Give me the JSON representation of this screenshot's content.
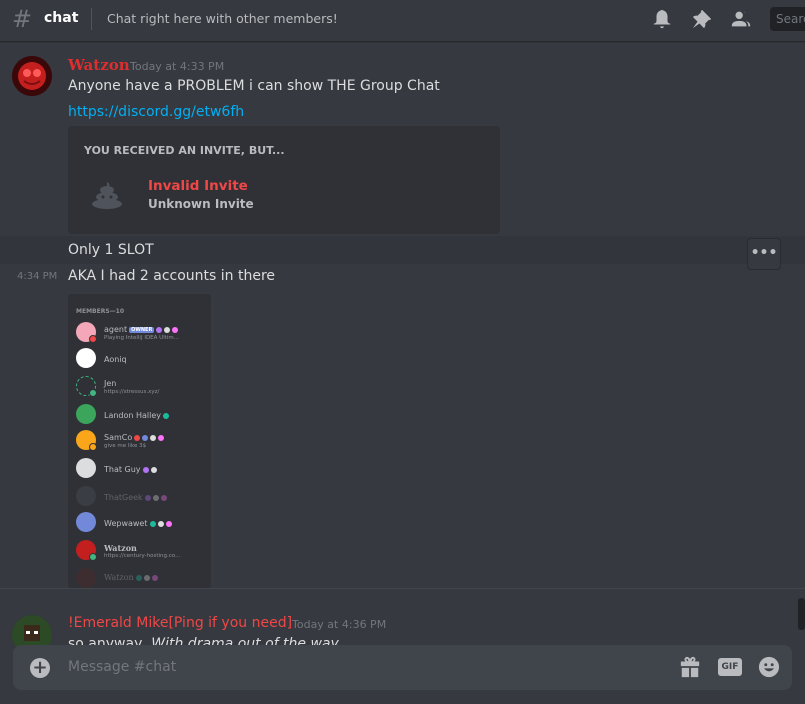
{
  "header": {
    "channel_name": "chat",
    "topic": "Chat right here with other members!",
    "search_placeholder": "Search",
    "icons": [
      "bell-icon",
      "pin-icon",
      "members-icon"
    ]
  },
  "messages": [
    {
      "author": "Watzon",
      "author_color": "#e02d2d",
      "timestamp": "Today at 4:33 PM",
      "lines": [
        "Anyone have a PROBLEM i can show THE Group Chat"
      ],
      "link": "https://discord.gg/etw6fh",
      "invite": {
        "header": "YOU RECEIVED AN INVITE, BUT...",
        "title": "Invalid Invite",
        "subtitle": "Unknown Invite"
      },
      "after": "Only 1 SLOT"
    },
    {
      "timestamp": "4:34 PM",
      "text": "AKA I had 2 accounts in there"
    },
    {
      "author": "!Emerald Mike[Ping if you need]",
      "author_color": "#f04747",
      "timestamp": "Today at 4:36 PM",
      "text_plain": "so anyway, ",
      "text_italic": "With drama out of the way"
    }
  ],
  "member_list": {
    "header": "MEMBERS—10",
    "members": [
      {
        "name": "agent",
        "badge": "OWNER",
        "activity": "Playing IntelliJ IDEA Ultim...",
        "avatar_color": "#f4a7b9",
        "status_color": "#f04747"
      },
      {
        "name": "Aoniq",
        "activity": "",
        "avatar_color": "#ffffff",
        "status_color": ""
      },
      {
        "name": "Jen",
        "activity": "https://stressus.xyz/",
        "avatar_color": "#43b581",
        "status_color": "#43b581"
      },
      {
        "name": "Landon Halley",
        "activity": "",
        "avatar_color": "#3ba55c",
        "status_color": ""
      },
      {
        "name": "SamCo",
        "activity": "give me like 3$",
        "avatar_color": "#faa61a",
        "status_color": "#faa61a"
      },
      {
        "name": "That Guy",
        "activity": "",
        "avatar_color": "#dcddde",
        "status_color": ""
      },
      {
        "name": "ThatGeek",
        "activity": "",
        "avatar_color": "#4f545c",
        "status_color": ""
      },
      {
        "name": "Wepwawet",
        "activity": "",
        "avatar_color": "#7289da",
        "status_color": ""
      },
      {
        "name": "Watzon",
        "activity": "https://century-hosting.co...",
        "avatar_color": "#c41f1f",
        "status_color": "#43b581"
      },
      {
        "name": "Watzon",
        "activity": "",
        "avatar_color": "#5a2a2a",
        "status_color": ""
      }
    ]
  },
  "more_button": "•••",
  "composer": {
    "placeholder": "Message #chat",
    "gif_label": "GIF",
    "icons": [
      "gift-icon",
      "gif-icon",
      "emoji-icon"
    ]
  }
}
